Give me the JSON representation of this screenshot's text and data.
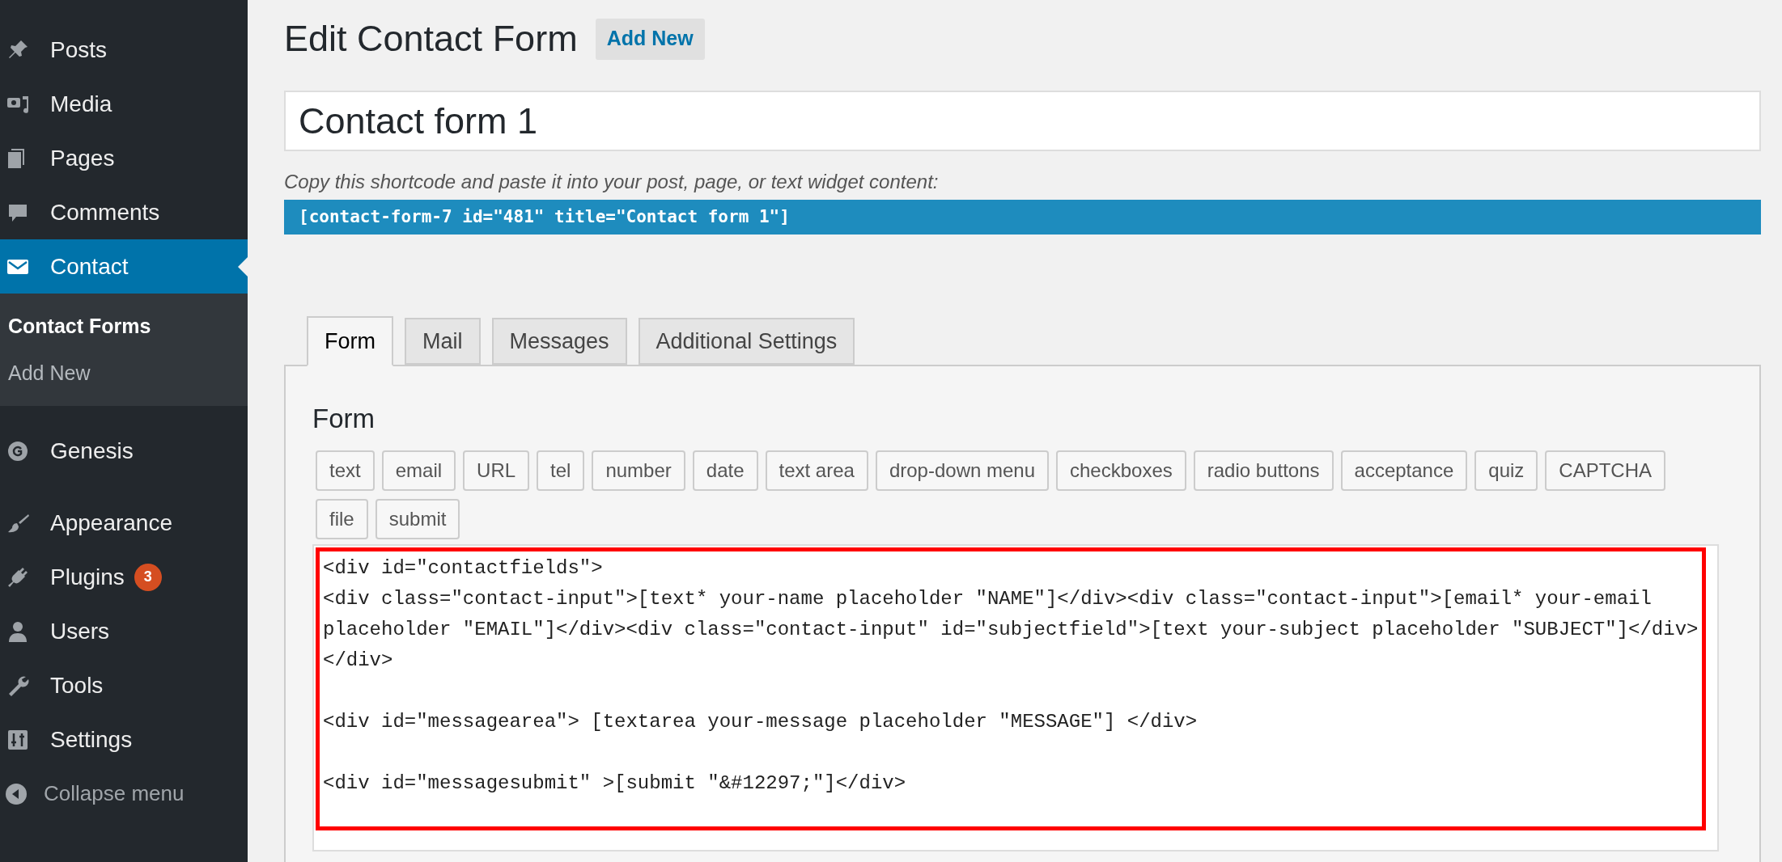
{
  "sidebar": {
    "menu_groups": [
      [
        {
          "label": "Posts",
          "selected": false
        },
        {
          "label": "Media",
          "selected": false
        },
        {
          "label": "Pages",
          "selected": false
        },
        {
          "label": "Comments",
          "selected": false
        },
        {
          "label": "Contact",
          "selected": true,
          "children": [
            {
              "label": "Contact Forms",
              "selected": true
            },
            {
              "label": "Add New",
              "selected": false
            }
          ]
        }
      ],
      [
        {
          "label": "Genesis",
          "selected": false
        }
      ],
      [
        {
          "label": "Appearance",
          "selected": false
        },
        {
          "label": "Plugins",
          "selected": false,
          "badge": "3"
        },
        {
          "label": "Users",
          "selected": false
        },
        {
          "label": "Tools",
          "selected": false
        },
        {
          "label": "Settings",
          "selected": false
        }
      ]
    ],
    "collapse_menu": "Collapse menu"
  },
  "page_title": "Edit Contact Form",
  "add_new_button": "Add New",
  "title_field": {
    "value": "Contact form 1"
  },
  "shortcode_hint": "Copy this shortcode and paste it into your post, page, or text widget content:",
  "shortcode": "[contact-form-7 id=\"481\" title=\"Contact form 1\"]",
  "tabs": [
    {
      "label": "Form",
      "selected": true
    },
    {
      "label": "Mail",
      "selected": false
    },
    {
      "label": "Messages",
      "selected": false
    },
    {
      "label": "Additional Settings",
      "selected": false
    }
  ],
  "panel": {
    "heading": "Form",
    "tag_buttons": [
      "text",
      "email",
      "URL",
      "tel",
      "number",
      "date",
      "text area",
      "drop-down menu",
      "checkboxes",
      "radio buttons",
      "acceptance",
      "quiz",
      "CAPTCHA",
      "file",
      "submit"
    ],
    "code_blocks": [
      [
        "<div id=\"contactfields\">",
        "<div class=\"contact-input\">[text* your-name placeholder \"NAME\"]</div><div class=\"contact-input\">[email* your-email placeholder \"EMAIL\"]</div><div class=\"contact-input\" id=\"subjectfield\">[text your-subject placeholder \"SUBJECT\"]</div>",
        "</div>"
      ],
      [
        "<div id=\"messagearea\"> [textarea your-message placeholder \"MESSAGE\"] </div>"
      ],
      [
        "<div id=\"messagesubmit\" >[submit \"&#12297;\"]</div>"
      ]
    ]
  }
}
